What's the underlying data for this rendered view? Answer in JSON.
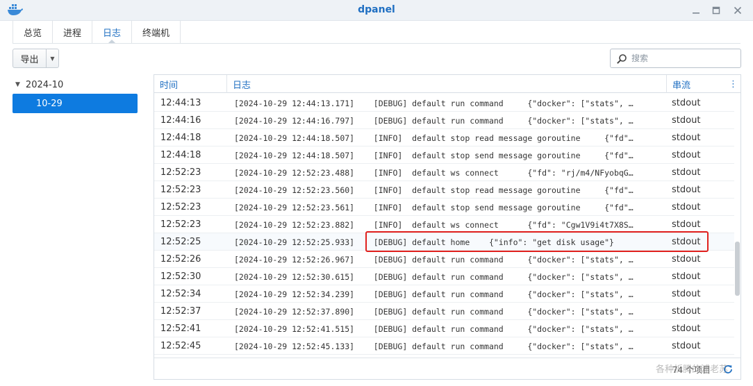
{
  "window": {
    "title": "dpanel",
    "icons": {
      "logo": "docker-whale-icon",
      "minimize": "minimize-icon",
      "maximize": "maximize-icon",
      "close": "close-icon"
    }
  },
  "tabs": [
    {
      "label": "总览",
      "active": false
    },
    {
      "label": "进程",
      "active": false
    },
    {
      "label": "日志",
      "active": true
    },
    {
      "label": "终端机",
      "active": false
    }
  ],
  "toolbar": {
    "export_label": "导出",
    "search": {
      "placeholder": "搜索",
      "value": ""
    }
  },
  "tree": {
    "month": "2024-10",
    "day": "10-29"
  },
  "grid": {
    "columns": {
      "time": "时间",
      "log": "日志",
      "stream": "串流"
    },
    "rows": [
      {
        "time": "12:44:13",
        "log": "[2024-10-29 12:44:13.171]    [DEBUG] default run command     {\"docker\": [\"stats\", …",
        "stream": "stdout"
      },
      {
        "time": "12:44:16",
        "log": "[2024-10-29 12:44:16.797]    [DEBUG] default run command     {\"docker\": [\"stats\", …",
        "stream": "stdout"
      },
      {
        "time": "12:44:18",
        "log": "[2024-10-29 12:44:18.507]    [INFO]  default stop read message goroutine     {\"fd\"…",
        "stream": "stdout"
      },
      {
        "time": "12:44:18",
        "log": "[2024-10-29 12:44:18.507]    [INFO]  default stop send message goroutine     {\"fd\"…",
        "stream": "stdout"
      },
      {
        "time": "12:52:23",
        "log": "[2024-10-29 12:52:23.488]    [INFO]  default ws connect      {\"fd\": \"rj/m4/NFyobqG…",
        "stream": "stdout"
      },
      {
        "time": "12:52:23",
        "log": "[2024-10-29 12:52:23.560]    [INFO]  default stop read message goroutine     {\"fd\"…",
        "stream": "stdout"
      },
      {
        "time": "12:52:23",
        "log": "[2024-10-29 12:52:23.561]    [INFO]  default stop send message goroutine     {\"fd\"…",
        "stream": "stdout"
      },
      {
        "time": "12:52:23",
        "log": "[2024-10-29 12:52:23.882]    [INFO]  default ws connect      {\"fd\": \"Cgw1V9i4t7X8S…",
        "stream": "stdout"
      },
      {
        "time": "12:52:25",
        "log": "[2024-10-29 12:52:25.933]    [DEBUG] default home    {\"info\": \"get disk usage\"}",
        "stream": "stdout"
      },
      {
        "time": "12:52:26",
        "log": "[2024-10-29 12:52:26.967]    [DEBUG] default run command     {\"docker\": [\"stats\", …",
        "stream": "stdout"
      },
      {
        "time": "12:52:30",
        "log": "[2024-10-29 12:52:30.615]    [DEBUG] default run command     {\"docker\": [\"stats\", …",
        "stream": "stdout"
      },
      {
        "time": "12:52:34",
        "log": "[2024-10-29 12:52:34.239]    [DEBUG] default run command     {\"docker\": [\"stats\", …",
        "stream": "stdout"
      },
      {
        "time": "12:52:37",
        "log": "[2024-10-29 12:52:37.890]    [DEBUG] default run command     {\"docker\": [\"stats\", …",
        "stream": "stdout"
      },
      {
        "time": "12:52:41",
        "log": "[2024-10-29 12:52:41.515]    [DEBUG] default run command     {\"docker\": [\"stats\", …",
        "stream": "stdout"
      },
      {
        "time": "12:52:45",
        "log": "[2024-10-29 12:52:45.133]    [DEBUG] default run command     {\"docker\": [\"stats\", …",
        "stream": "stdout"
      }
    ],
    "highlighted_row": 8,
    "footer_count": "74 个项目"
  },
  "watermark": "各种折腾的浦老苏",
  "colors": {
    "accent": "#1f6fc2",
    "selected": "#0e7be0",
    "highlight_border": "#e0201d"
  }
}
